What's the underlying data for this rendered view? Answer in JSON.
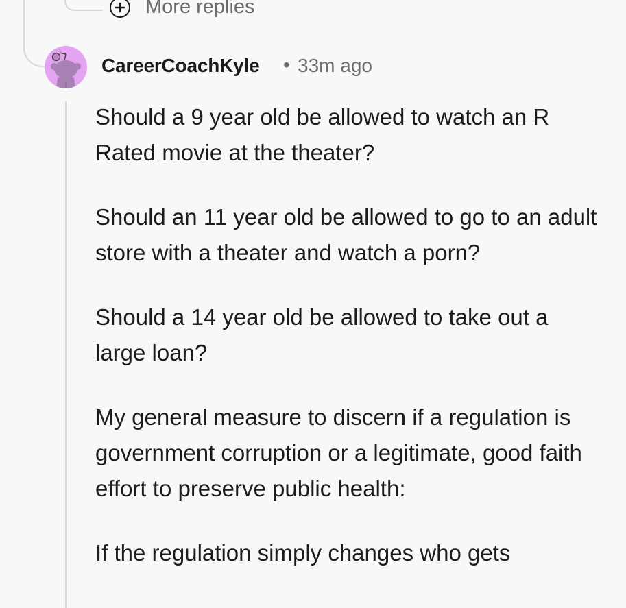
{
  "thread": {
    "more_replies_label": "More replies"
  },
  "comment": {
    "author": "CareerCoachKyle",
    "separator": "•",
    "timestamp": "33m ago",
    "avatar_icon": "snoo-avatar-icon",
    "avatar_color": "#e3a5f1",
    "paragraphs": [
      "Should a 9 year old be allowed to watch an R Rated movie at the theater?",
      "Should an 11 year old be allowed to go to an adult store with a theater and watch a porn?",
      "Should a 14 year old be allowed to take out a large loan?",
      "My general measure to discern if a regulation is government corruption or a legitimate, good faith effort to preserve public health:",
      "If the regulation simply changes who gets"
    ]
  }
}
